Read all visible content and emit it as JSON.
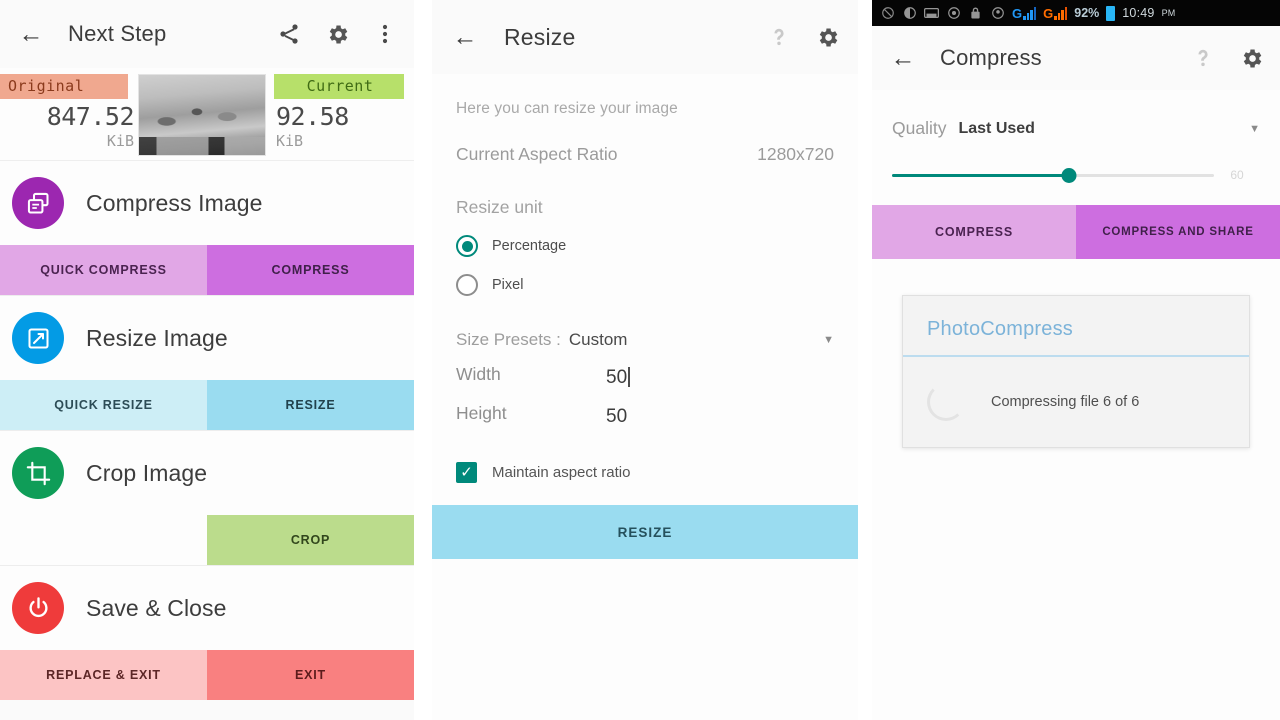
{
  "panel1": {
    "appbar": {
      "title": "Next Step",
      "back_icon": "back-arrow-icon",
      "share_icon": "share-icon",
      "settings_icon": "gear-icon",
      "overflow_icon": "more-vertical-icon"
    },
    "sizes": {
      "original_label": "Original",
      "original_value": "847.52",
      "original_unit": "KiB",
      "current_label": "Current",
      "current_value": "92.58",
      "current_unit": "KiB"
    },
    "features": [
      {
        "title": "Compress Image",
        "icon": "compress-image-icon",
        "icon_color": "#9c27b0",
        "buttons": [
          {
            "label": "QUICK COMPRESS",
            "color": "#e1a7e6"
          },
          {
            "label": "COMPRESS",
            "color": "#cd6ee0"
          }
        ]
      },
      {
        "title": "Resize Image",
        "icon": "resize-image-icon",
        "icon_color": "#039be5",
        "buttons": [
          {
            "label": "QUICK RESIZE",
            "color": "#cdeef6"
          },
          {
            "label": "RESIZE",
            "color": "#9adcf0"
          }
        ]
      },
      {
        "title": "Crop Image",
        "icon": "crop-image-icon",
        "icon_color": "#0f9d58",
        "buttons": [
          {
            "label": "",
            "color": "#fdfdfd"
          },
          {
            "label": "CROP",
            "color": "#bbdc8c"
          }
        ]
      },
      {
        "title": "Save & Close",
        "icon": "power-icon",
        "icon_color": "#ef3b3b",
        "buttons": [
          {
            "label": "REPLACE & EXIT",
            "color": "#fcc4c4"
          },
          {
            "label": "EXIT",
            "color": "#f98080"
          }
        ]
      }
    ]
  },
  "panel2": {
    "appbar": {
      "title": "Resize",
      "back_icon": "back-arrow-icon",
      "help_icon": "help-icon",
      "settings_icon": "gear-icon"
    },
    "hint": "Here you can resize your image",
    "aspect_ratio_label": "Current Aspect Ratio",
    "aspect_ratio_value": "1280x720",
    "resize_unit_label": "Resize unit",
    "unit_options": [
      {
        "label": "Percentage",
        "selected": true
      },
      {
        "label": "Pixel",
        "selected": false
      }
    ],
    "size_presets_label": "Size Presets :",
    "size_presets_value": "Custom",
    "width_label": "Width",
    "width_value": "50",
    "height_label": "Height",
    "height_value": "50",
    "maintain_label": "Maintain aspect ratio",
    "maintain_checked": true,
    "resize_button": "RESIZE"
  },
  "panel3": {
    "statusbar": {
      "icons": [
        "no-sound-icon",
        "contrast-icon",
        "sd-card-icon",
        "camera-icon",
        "lock-icon",
        "app-icon"
      ],
      "sim1_letter": "G",
      "sim2_letter": "G",
      "sim1_color": "#2196f3",
      "sim2_color": "#ff6d00",
      "battery_pct": "92%",
      "time": "10:49",
      "meridiem": "PM"
    },
    "appbar": {
      "title": "Compress",
      "back_icon": "back-arrow-icon",
      "help_icon": "help-icon",
      "settings_icon": "gear-icon"
    },
    "quality_label": "Quality",
    "quality_value": "Last Used",
    "slider_value": "60",
    "buttons": [
      {
        "label": "COMPRESS",
        "color": "#e1a7e6"
      },
      {
        "label": "COMPRESS AND SHARE",
        "color": "#cd6ee0"
      }
    ],
    "dialog": {
      "title": "PhotoCompress",
      "message": "Compressing file 6 of 6",
      "spinner_icon": "loading-spinner-icon"
    }
  }
}
